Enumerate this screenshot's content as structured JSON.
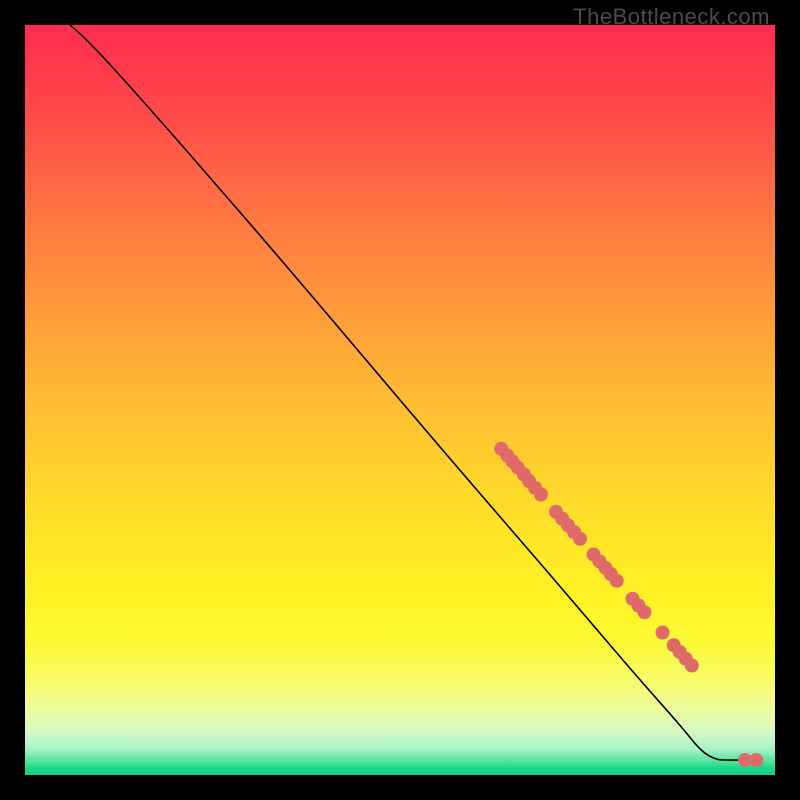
{
  "watermark": "TheBottleneck.com",
  "chart_data": {
    "type": "line",
    "title": "",
    "xlabel": "",
    "ylabel": "",
    "xlim": [
      0,
      100
    ],
    "ylim": [
      0,
      100
    ],
    "grid": false,
    "legend": false,
    "curve": [
      {
        "x": 6.0,
        "y": 100.0
      },
      {
        "x": 8.0,
        "y": 98.2
      },
      {
        "x": 12.0,
        "y": 94.0
      },
      {
        "x": 20.0,
        "y": 85.0
      },
      {
        "x": 30.0,
        "y": 73.5
      },
      {
        "x": 40.0,
        "y": 61.8
      },
      {
        "x": 50.0,
        "y": 50.0
      },
      {
        "x": 60.0,
        "y": 38.3
      },
      {
        "x": 70.0,
        "y": 26.7
      },
      {
        "x": 80.0,
        "y": 15.0
      },
      {
        "x": 87.0,
        "y": 7.0
      },
      {
        "x": 90.0,
        "y": 3.5
      },
      {
        "x": 92.0,
        "y": 2.2
      },
      {
        "x": 93.5,
        "y": 2.0
      },
      {
        "x": 96.0,
        "y": 2.0
      },
      {
        "x": 97.5,
        "y": 2.0
      }
    ],
    "markers": [
      {
        "x": 63.5,
        "y": 43.5
      },
      {
        "x": 64.3,
        "y": 42.6
      },
      {
        "x": 65.0,
        "y": 41.8
      },
      {
        "x": 65.7,
        "y": 41.0
      },
      {
        "x": 66.5,
        "y": 40.1
      },
      {
        "x": 67.2,
        "y": 39.2
      },
      {
        "x": 68.0,
        "y": 38.3
      },
      {
        "x": 68.8,
        "y": 37.4
      },
      {
        "x": 70.8,
        "y": 35.1
      },
      {
        "x": 71.6,
        "y": 34.2
      },
      {
        "x": 72.4,
        "y": 33.3
      },
      {
        "x": 73.2,
        "y": 32.4
      },
      {
        "x": 74.0,
        "y": 31.5
      },
      {
        "x": 75.8,
        "y": 29.4
      },
      {
        "x": 76.6,
        "y": 28.5
      },
      {
        "x": 77.4,
        "y": 27.6
      },
      {
        "x": 78.1,
        "y": 26.8
      },
      {
        "x": 78.9,
        "y": 25.9
      },
      {
        "x": 81.0,
        "y": 23.5
      },
      {
        "x": 81.8,
        "y": 22.6
      },
      {
        "x": 82.6,
        "y": 21.7
      },
      {
        "x": 85.0,
        "y": 19.0
      },
      {
        "x": 86.5,
        "y": 17.3
      },
      {
        "x": 87.3,
        "y": 16.4
      },
      {
        "x": 88.1,
        "y": 15.5
      },
      {
        "x": 88.9,
        "y": 14.6
      },
      {
        "x": 96.0,
        "y": 2.0
      },
      {
        "x": 97.5,
        "y": 2.0
      }
    ],
    "colors": {
      "curve": "#000000",
      "markers": "#e06a6a",
      "gradient_top": "#ff2c4e",
      "gradient_bottom": "#0fd084"
    }
  }
}
